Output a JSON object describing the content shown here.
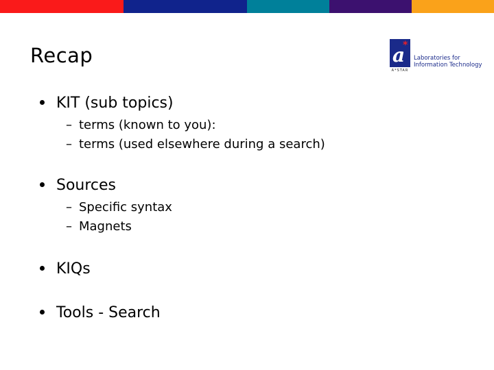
{
  "top_bar": {
    "colors": [
      "#fa1a1a",
      "#10238c",
      "#00809a",
      "#3c116f",
      "#faa21a"
    ]
  },
  "slide": {
    "title": "Recap",
    "logo": {
      "mark_letter": "a",
      "mark_star": "*",
      "org": "A*STAR",
      "line1": "Laboratories for",
      "line2": "Information Technology"
    },
    "bullets": [
      {
        "text": "KIT (sub topics)",
        "sub": [
          "terms (known to you):",
          "terms (used elsewhere during a search)"
        ]
      },
      {
        "text": "Sources",
        "sub": [
          "Specific syntax",
          "Magnets"
        ]
      },
      {
        "text": "KIQs",
        "sub": []
      },
      {
        "text": "Tools - Search",
        "sub": []
      }
    ],
    "bullet_glyph": "•",
    "sub_glyph": "–"
  }
}
